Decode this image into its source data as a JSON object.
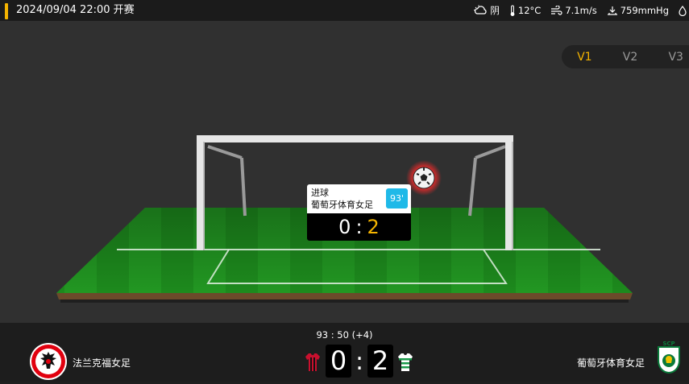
{
  "header": {
    "match_time": "2024/09/04 22:00 开赛",
    "weather": [
      {
        "icon": "cloudy-weather-icon",
        "value": "阴"
      },
      {
        "icon": "thermometer-icon",
        "value": "12°C"
      },
      {
        "icon": "wind-icon",
        "value": "7.1m/s"
      },
      {
        "icon": "pressure-icon",
        "value": "759mmHg"
      },
      {
        "icon": "humidity-drop-icon",
        "value": ""
      }
    ]
  },
  "view_tabs": [
    "V1",
    "V2",
    "V3"
  ],
  "active_view": "V1",
  "event_popup": {
    "event": "进球",
    "team": "葡萄牙体育女足",
    "minute": "93'",
    "home_score": "0",
    "away_score": "2"
  },
  "scoreboard": {
    "clock": "93 : 50  (+4)",
    "home": {
      "name": "法兰克福女足",
      "score": "0",
      "logo": "eagle-crest-icon",
      "kit": "red-black-stripes"
    },
    "away": {
      "name": "葡萄牙体育女足",
      "score": "2",
      "logo": "lion-crest-icon",
      "kit": "green-white-hoops"
    }
  },
  "colors": {
    "accent": "#f5b400",
    "minute_badge": "#1fb9e8",
    "pitch": "#1e8c1e"
  }
}
